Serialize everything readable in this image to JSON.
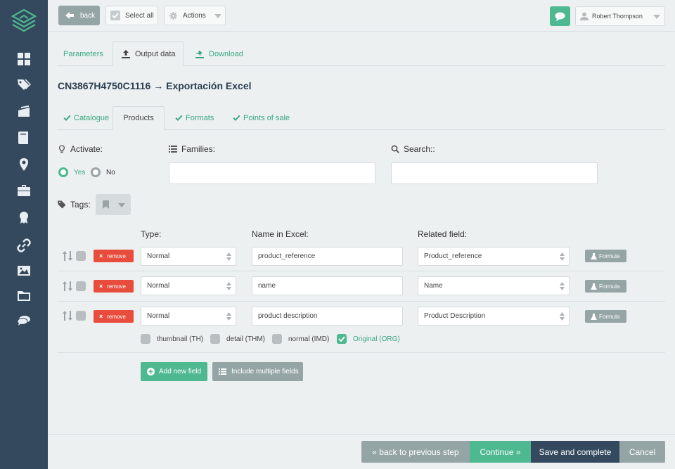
{
  "toolbar": {
    "back_label": "back",
    "select_all_label": "Select all",
    "actions_label": "Actions",
    "user_name": "Robert Thompson"
  },
  "main_tabs": [
    {
      "label": "Parameters"
    },
    {
      "label": "Output data"
    },
    {
      "label": "Download"
    }
  ],
  "page_title": "CN3867H4750C1116 → Exportación Excel",
  "sub_tabs": [
    {
      "label": "Catalogue"
    },
    {
      "label": "Products"
    },
    {
      "label": "Formats"
    },
    {
      "label": "Points of sale"
    }
  ],
  "filters": {
    "activate_label": "Activate:",
    "yes_label": "Yes",
    "no_label": "No",
    "activate_value": "Yes",
    "families_label": "Families:",
    "search_label": "Search::",
    "tags_label": "Tags:"
  },
  "columns": {
    "type": "Type:",
    "name_in_excel": "Name in Excel:",
    "related_field": "Related field:"
  },
  "rows": [
    {
      "remove": "remove",
      "type": "Normal",
      "name": "product_reference",
      "related": "Product_reference",
      "formula": "Formula"
    },
    {
      "remove": "remove",
      "type": "Normal",
      "name": "name",
      "related": "Name",
      "formula": "Formula"
    },
    {
      "remove": "remove",
      "type": "Normal",
      "name": "product description",
      "related": "Product Description",
      "formula": "Formula"
    }
  ],
  "image_options": [
    {
      "label": "thumbnail (TH)",
      "checked": false
    },
    {
      "label": "detail (THM)",
      "checked": false
    },
    {
      "label": "normal (IMD)",
      "checked": false
    },
    {
      "label": "Original (ORG)",
      "checked": true
    }
  ],
  "buttons": {
    "add_new_field": "Add new field",
    "include_multiple": "Include multiple fields"
  },
  "footer": {
    "back_step": "« back to previous step",
    "continue": "Continue »",
    "save_complete": "Save and complete",
    "cancel": "Cancel"
  },
  "colors": {
    "sidebar": "#34495e",
    "accent_green": "#4eb890",
    "remove_red": "#e74c3c",
    "neutral_grey": "#95a5a6",
    "dark_navy": "#34495e"
  }
}
